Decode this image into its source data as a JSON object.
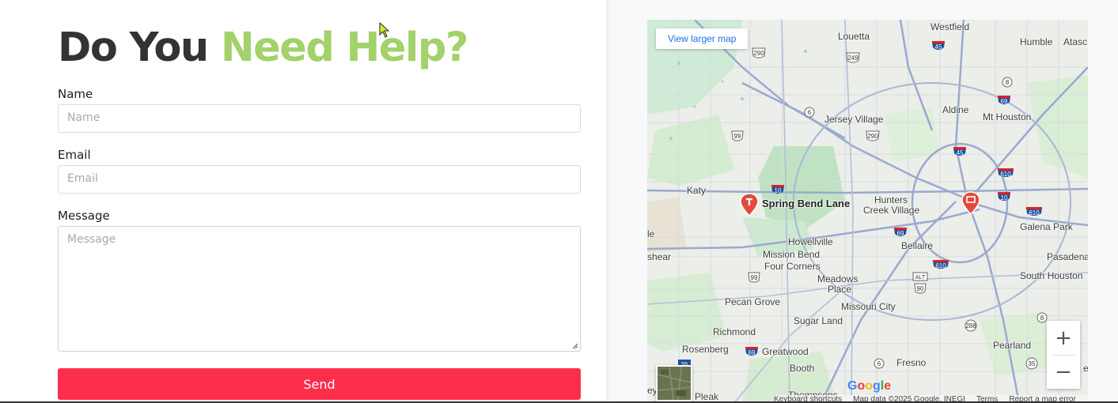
{
  "form": {
    "title_part1": "Do You",
    "title_part2": "Need Help?",
    "name_label": "Name",
    "name_placeholder": "Name",
    "email_label": "Email",
    "email_placeholder": "Email",
    "message_label": "Message",
    "message_placeholder": "Message",
    "send_label": "Send",
    "accent_color": "#a3d16a",
    "button_color": "#fd2d4c"
  },
  "map": {
    "view_larger_label": "View larger map",
    "zoom_in_label": "+",
    "zoom_out_label": "−",
    "google_logo": "Google",
    "attribution": {
      "shortcuts": "Keyboard shortcuts",
      "map_data": "Map data ©2025 Google, INEGI",
      "terms": "Terms",
      "report": "Report a map error"
    },
    "places": {
      "westfield": "Westfield",
      "louetta": "Louetta",
      "humble": "Humble",
      "atasc": "Atasc",
      "aldine": "Aldine",
      "mt_houston": "Mt Houston",
      "jersey_village": "Jersey Village",
      "katy": "Katy",
      "spring_bend_lane": "Spring Bend Lane",
      "hunters_creek_1": "Hunters",
      "hunters_creek_2": "Creek Village",
      "galena_park": "Galena Park",
      "le": "le",
      "howellville": "Howellville",
      "mission_bend": "Mission Bend",
      "four_corners": "Four Corners",
      "bellaire": "Bellaire",
      "pasadena": "Pasadena",
      "shear": "shear",
      "meadows_place_1": "Meadows",
      "meadows_place_2": "Place",
      "south_houston": "South Houston",
      "pecan_grove": "Pecan Grove",
      "missouri_city": "Missouri City",
      "richmond": "Richmond",
      "sugar_land": "Sugar Land",
      "rosenberg": "Rosenberg",
      "greatwood": "Greatwood",
      "pearland": "Pearland",
      "booth": "Booth",
      "fresno": "Fresno",
      "pleak": "Pleak",
      "thompsons": "Thompsons",
      "ey": "ey",
      "we": "e"
    },
    "shields": {
      "s290a": "290",
      "s249": "249",
      "s45a": "45",
      "s8a": "8",
      "s69a": "69",
      "s6a": "6",
      "s290b": "290",
      "s99a": "99",
      "s45b": "45",
      "s610a": "610",
      "s10a": "10",
      "s10b": "10",
      "s610b": "610",
      "s69b": "69",
      "s610c": "610",
      "s99b": "99",
      "salt": "ALT",
      "s90": "90",
      "s8b": "8",
      "s288": "288",
      "s69c": "69",
      "s6b": "6",
      "s35": "35",
      "s59": "59"
    }
  }
}
